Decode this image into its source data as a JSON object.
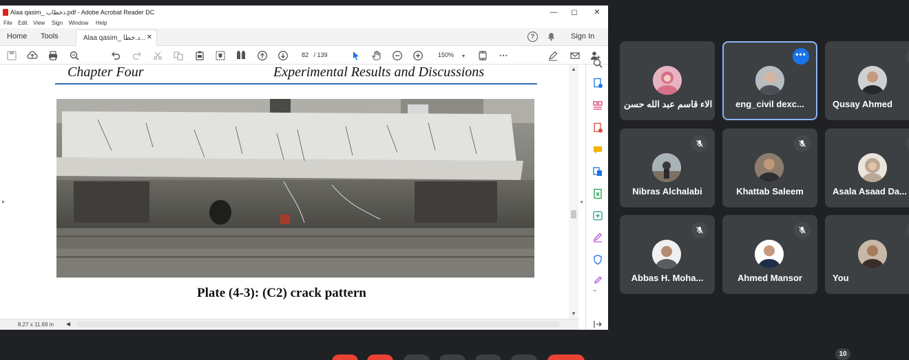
{
  "acrobat": {
    "title": "Alaa qasim_ دخطاب.pdf - Adobe Acrobat Reader DC",
    "menu": [
      "File",
      "Edit",
      "View",
      "Sign",
      "Window",
      "Help"
    ],
    "tabs": {
      "home": "Home",
      "tools": "Tools",
      "doc": "Alaa qasim_ د.خطا..."
    },
    "sign_in": "Sign In",
    "page_current": "82",
    "page_total": "/ 139",
    "zoom": "150%",
    "status_dims": "8.27 x 11.69 in"
  },
  "document": {
    "chapter": "Chapter Four",
    "section": "Experimental Results and Discussions",
    "caption": "Plate (4-3): (C2) crack pattern"
  },
  "meet": {
    "participants": [
      {
        "name": "الاء قاسم عبد الله حسن",
        "muted": false,
        "active": false,
        "avatar_color": "#d9708a"
      },
      {
        "name": "eng_civil dexc...",
        "muted": false,
        "active": true,
        "avatar_color": "#8a8f94"
      },
      {
        "name": "Qusay Ahmed",
        "muted": true,
        "active": false,
        "avatar_color": "#6b6f74"
      },
      {
        "name": "Nibras Alchalabi",
        "muted": true,
        "active": false,
        "avatar_color": "#a2927a"
      },
      {
        "name": "Khattab Saleem",
        "muted": true,
        "active": false,
        "avatar_color": "#76685c"
      },
      {
        "name": "Asala Asaad Da...",
        "muted": true,
        "active": false,
        "avatar_color": "#c8b8a8"
      },
      {
        "name": "Abbas H. Moha...",
        "muted": true,
        "active": false,
        "avatar_color": "#8c8a86"
      },
      {
        "name": "Ahmed Mansor",
        "muted": true,
        "active": false,
        "avatar_color": "#4c5a72"
      },
      {
        "name": "You",
        "muted": true,
        "active": false,
        "avatar_color": "#6a5a50"
      }
    ],
    "participant_count": "10"
  },
  "colors": {
    "accent": "#1a73e8",
    "tile_bg": "#3c4043",
    "page_bg": "#202124",
    "end_call": "#ea4335"
  }
}
